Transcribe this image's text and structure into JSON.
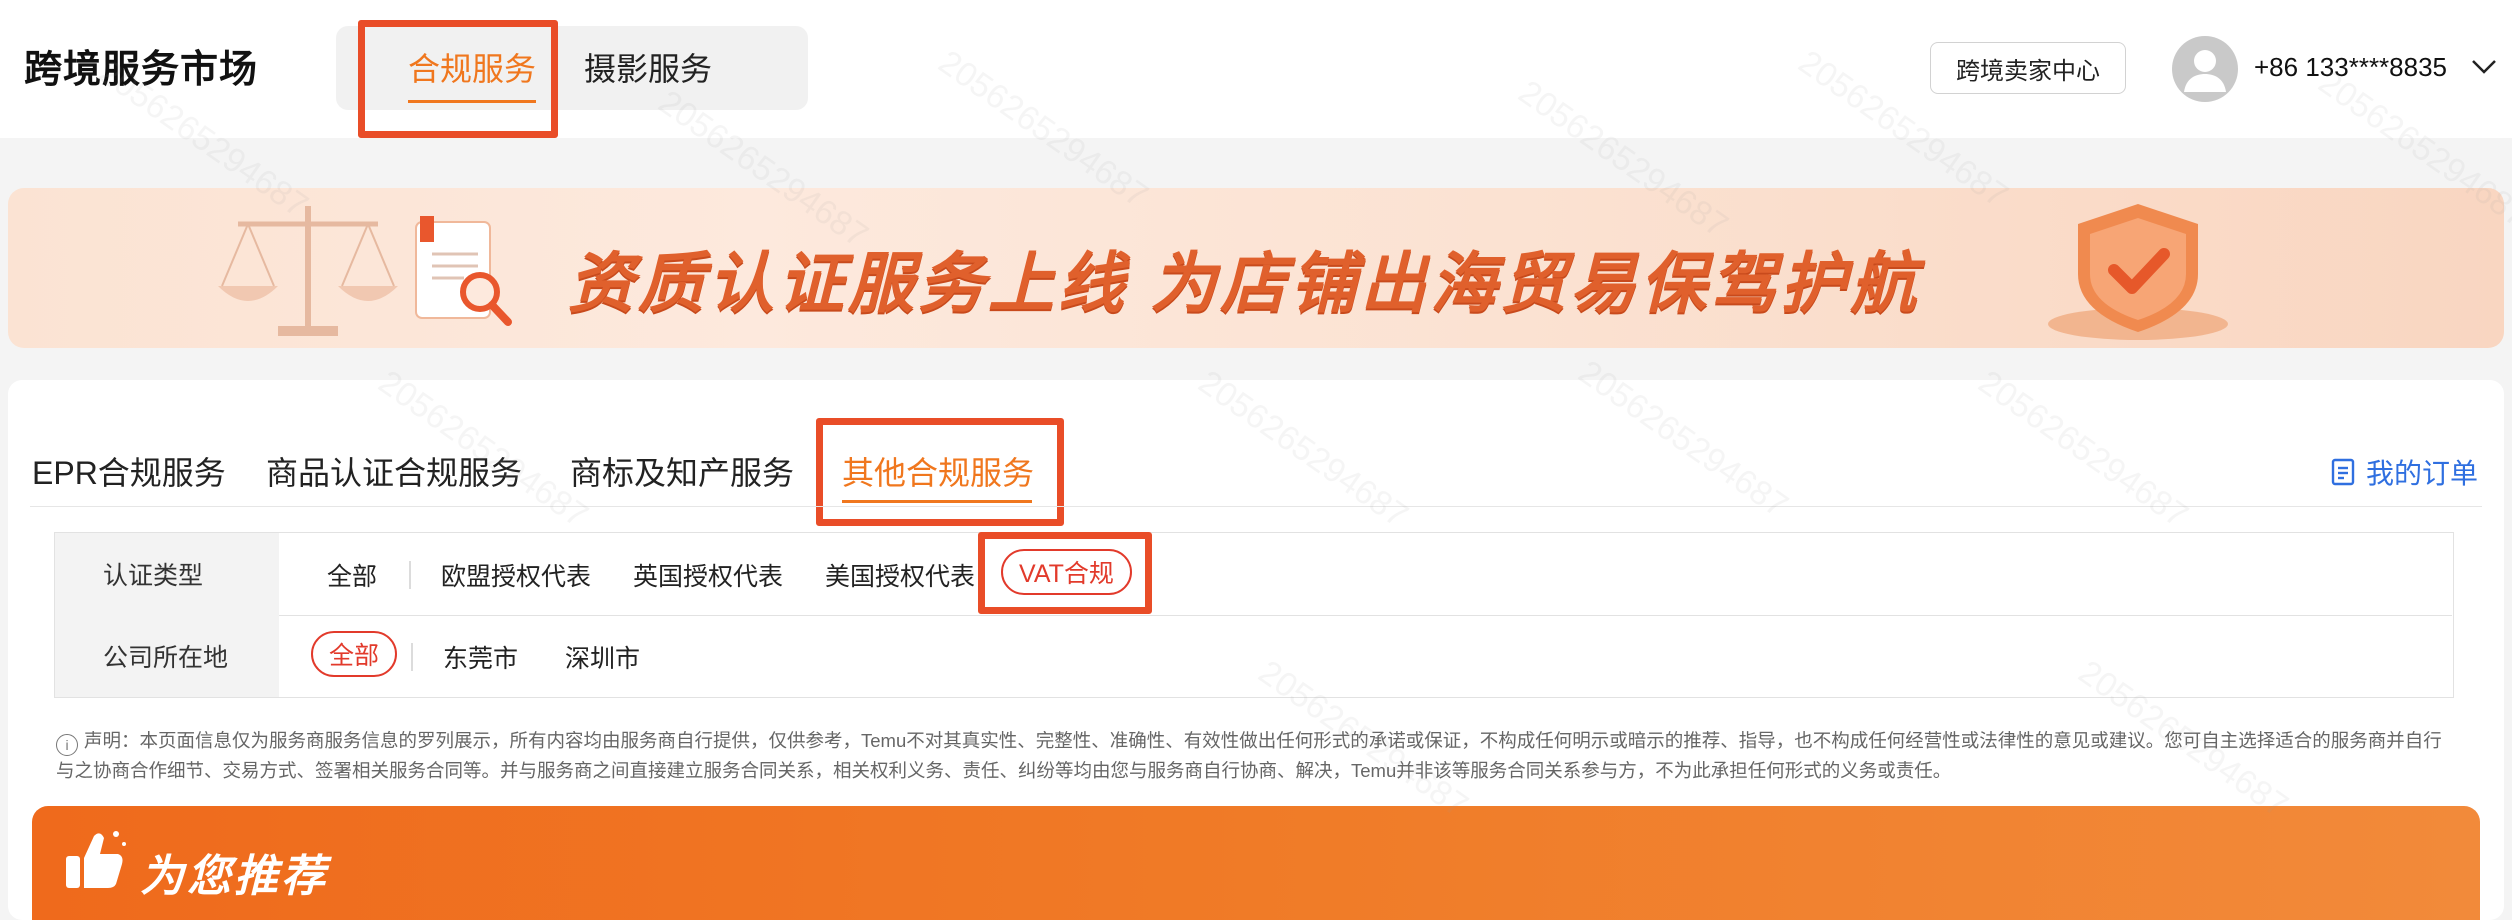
{
  "header": {
    "brand": "跨境服务市场",
    "nav_tabs": [
      {
        "label": "合规服务",
        "active": true
      },
      {
        "label": "摄影服务",
        "active": false
      }
    ],
    "seller_center": "跨境卖家中心",
    "phone": "+86 133****8835"
  },
  "banner": {
    "text": "资质认证服务上线  为店铺出海贸易保驾护航"
  },
  "content": {
    "tabs": [
      {
        "label": "EPR合规服务",
        "active": false
      },
      {
        "label": "商品认证合规服务",
        "active": false
      },
      {
        "label": "商标及知产服务",
        "active": false
      },
      {
        "label": "其他合规服务",
        "active": true
      }
    ],
    "my_orders": "我的订单"
  },
  "filters": {
    "cert_type": {
      "label": "认证类型",
      "options": [
        "全部",
        "欧盟授权代表",
        "英国授权代表",
        "美国授权代表",
        "VAT合规"
      ],
      "selected": "VAT合规"
    },
    "location": {
      "label": "公司所在地",
      "options": [
        "全部",
        "东莞市",
        "深圳市"
      ],
      "selected": "全部"
    }
  },
  "disclaimer": "声明：本页面信息仅为服务商服务信息的罗列展示，所有内容均由服务商自行提供，仅供参考，Temu不对其真实性、完整性、准确性、有效性做出任何形式的承诺或保证，不构成任何明示或暗示的推荐、指导，也不构成任何经营性或法律性的意见或建议。您可自主选择适合的服务商并自行与之协商合作细节、交易方式、签署相关服务合同等。并与服务商之间直接建立服务合同关系，相关权利义务、责任、纠纷等均由您与服务商自行协商、解决，Temu并非该等服务合同关系参与方，不为此承担任何形式的义务或责任。",
  "recommend": {
    "title": "为您推荐"
  },
  "watermark": "2056265294687",
  "colors": {
    "accent": "#f0771e",
    "highlight": "#e94d28",
    "selected_pill": "#e23a2b",
    "link": "#2f6fe0"
  }
}
